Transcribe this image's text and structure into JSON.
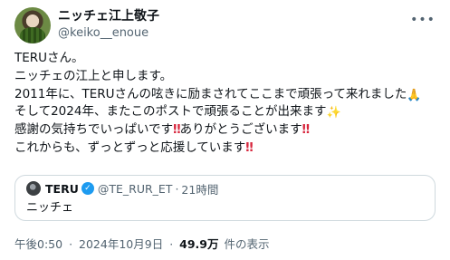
{
  "author": {
    "display_name": "ニッチェ江上敬子",
    "handle": "@keiko__enoue"
  },
  "more_icon": "more-horizontal-icon",
  "tweet": {
    "lines": [
      "TERUさん。",
      "ニッチェの江上と申します。",
      "2011年に、TERUさんの呟きに励まされてここまで頑張って来れました",
      "そして2024年、またこのポストで頑張ることが出来ます",
      "感謝の気持ちでいっぱいです",
      "ありがとうございます",
      "これからも、ずっとずっと応援しています"
    ],
    "emoji": {
      "pray": "🙏",
      "sparkles": "✨",
      "double_exclamation": "‼"
    }
  },
  "quoted": {
    "name": "TERU",
    "handle": "@TE_RUR_ET",
    "separator": "·",
    "time": "21時間",
    "text": "ニッチェ",
    "verified_color": "#1d9bf0"
  },
  "footer": {
    "time": "午後0:50",
    "separator": "·",
    "date": "2024年10月9日",
    "separator2": "·",
    "views_count": "49.9万",
    "views_label": "件の表示"
  }
}
